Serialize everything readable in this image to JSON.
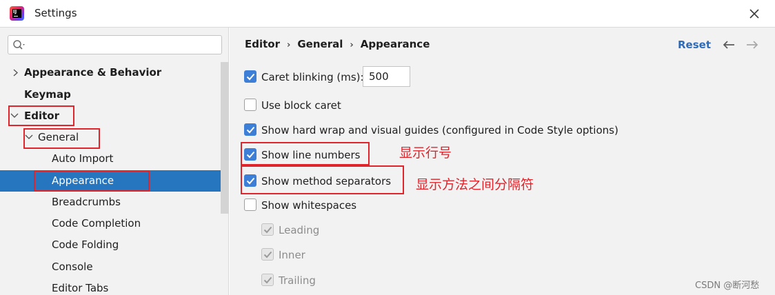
{
  "window": {
    "title": "Settings"
  },
  "sidebar": {
    "search_placeholder": "",
    "items": [
      {
        "label": "Appearance & Behavior"
      },
      {
        "label": "Keymap"
      },
      {
        "label": "Editor"
      },
      {
        "label": "General"
      },
      {
        "label": "Auto Import"
      },
      {
        "label": "Appearance"
      },
      {
        "label": "Breadcrumbs"
      },
      {
        "label": "Code Completion"
      },
      {
        "label": "Code Folding"
      },
      {
        "label": "Console"
      },
      {
        "label": "Editor Tabs"
      }
    ]
  },
  "main": {
    "breadcrumb": [
      "Editor",
      "General",
      "Appearance"
    ],
    "reset_label": "Reset",
    "options": [
      {
        "label": "Caret blinking (ms):",
        "checked": true
      },
      {
        "label": "Use block caret",
        "checked": false
      },
      {
        "label": "Show hard wrap and visual guides (configured in Code Style options)",
        "checked": true
      },
      {
        "label": "Show line numbers",
        "checked": true
      },
      {
        "label": "Show method separators",
        "checked": true
      },
      {
        "label": "Show whitespaces",
        "checked": false
      },
      {
        "label": "Leading",
        "checked": true,
        "disabled": true
      },
      {
        "label": "Inner",
        "checked": true,
        "disabled": true
      },
      {
        "label": "Trailing",
        "checked": true,
        "disabled": true
      }
    ],
    "caret_blink_value": "500"
  },
  "annotations": {
    "line_numbers": "显示行号",
    "method_separators": "显示方法之间分隔符"
  },
  "watermark": "CSDN @断河愁",
  "colors": {
    "selection": "#2675bf",
    "checkbox_checked": "#3d7fd6",
    "annotation_red": "#e0242b",
    "link": "#2f6bb8"
  }
}
